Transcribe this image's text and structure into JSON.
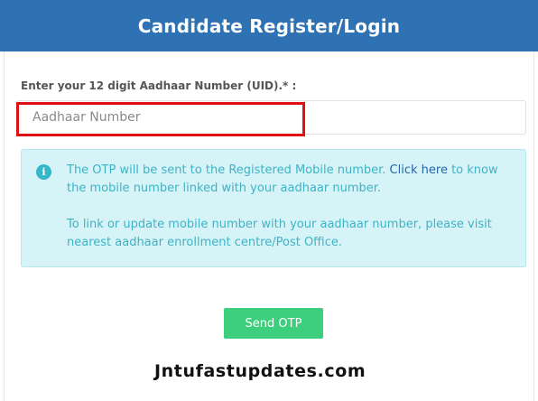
{
  "header": {
    "title": "Candidate Register/Login"
  },
  "form": {
    "aadhaar_label": "Enter your 12 digit Aadhaar Number (UID).* :",
    "aadhaar_placeholder": "Aadhaar Number",
    "aadhaar_value": ""
  },
  "info": {
    "icon": "info-icon",
    "line1_pre": "The OTP will be sent to the Registered Mobile number. ",
    "link_text": "Click here",
    "line1_post": " to know the mobile number linked with your aadhaar number.",
    "line2": "To link or update mobile number with your aadhaar number, please visit nearest aadhaar enrollment centre/Post Office."
  },
  "actions": {
    "send_otp_label": "Send OTP"
  },
  "watermark": {
    "text": "Jntufastupdates.com"
  },
  "colors": {
    "header_bg": "#2f72b3",
    "highlight": "#e01010",
    "info_bg": "#d6f3f7",
    "info_text": "#3eb3c6",
    "link": "#2466a8",
    "button_bg": "#3ecf7e"
  }
}
